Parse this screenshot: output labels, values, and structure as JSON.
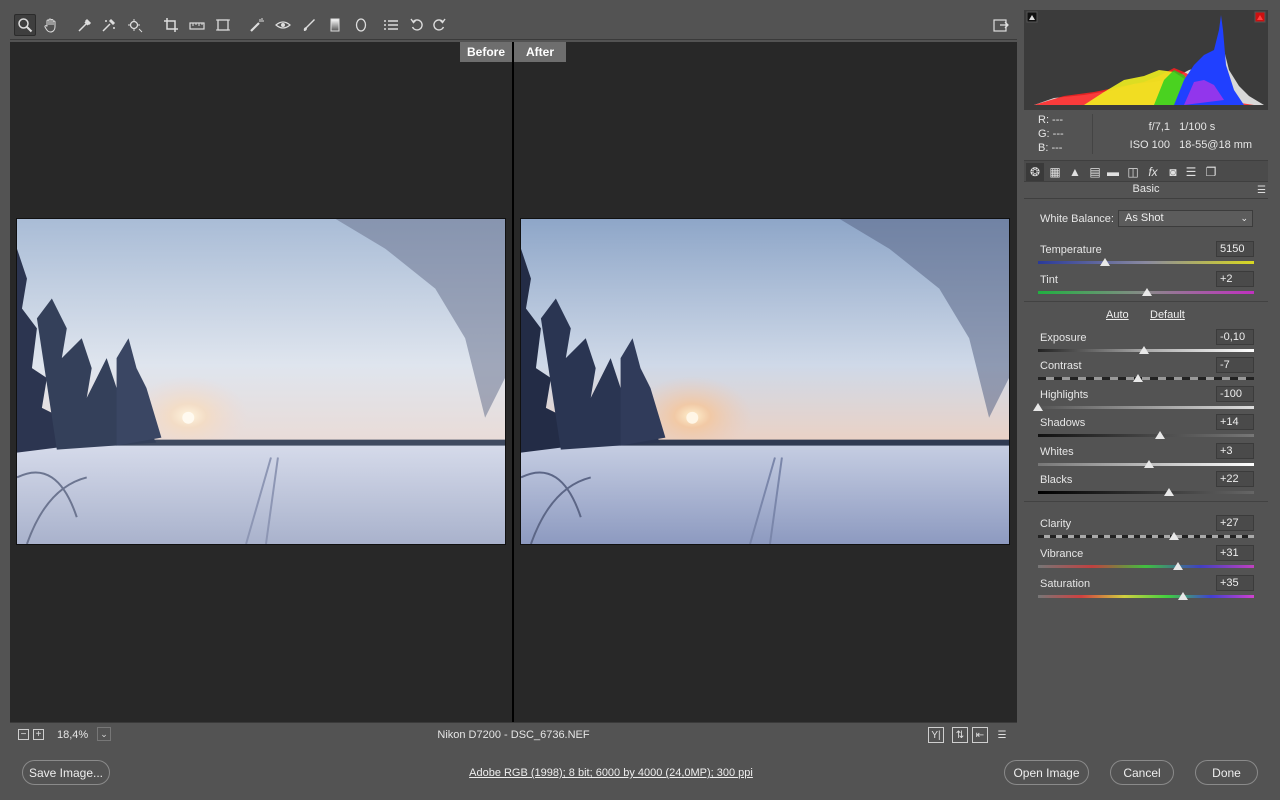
{
  "toolbar": {
    "tools": [
      {
        "name": "zoom-tool",
        "icon": "magnifier-icon"
      },
      {
        "name": "hand-tool",
        "icon": "hand-icon"
      },
      {
        "name": "white-balance-tool",
        "icon": "eyedropper-icon"
      },
      {
        "name": "color-sampler-tool",
        "icon": "sampler-icon"
      },
      {
        "name": "targeted-adjustment-tool",
        "icon": "target-adjust-icon"
      },
      {
        "name": "crop-tool",
        "icon": "crop-icon"
      },
      {
        "name": "straighten-tool",
        "icon": "straighten-icon"
      },
      {
        "name": "transform-tool",
        "icon": "transform-icon"
      },
      {
        "name": "spot-removal-tool",
        "icon": "spot-removal-icon"
      },
      {
        "name": "red-eye-tool",
        "icon": "red-eye-icon"
      },
      {
        "name": "adjustment-brush-tool",
        "icon": "brush-icon"
      },
      {
        "name": "graduated-filter-tool",
        "icon": "graduated-filter-icon"
      },
      {
        "name": "radial-filter-tool",
        "icon": "radial-filter-icon"
      },
      {
        "name": "preferences-tool",
        "icon": "list-icon"
      },
      {
        "name": "rotate-left-tool",
        "icon": "rotate-ccw-icon"
      },
      {
        "name": "rotate-right-tool",
        "icon": "rotate-cw-icon"
      }
    ]
  },
  "preview": {
    "before_label": "Before",
    "after_label": "After"
  },
  "status": {
    "zoom": "18,4%",
    "file_info": "Nikon D7200  -  DSC_6736.NEF"
  },
  "readout": {
    "r": "R:   ---",
    "g": "G:   ---",
    "b": "B:   ---",
    "aperture": "f/7,1",
    "shutter": "1/100 s",
    "iso": "ISO 100",
    "lens": "18-55@18 mm"
  },
  "panel": {
    "title": "Basic",
    "white_balance_label": "White Balance:",
    "white_balance_value": "As Shot",
    "auto_label": "Auto",
    "default_label": "Default",
    "sliders": [
      {
        "label": "Temperature",
        "value": "5150",
        "position": 0.31,
        "track": "linear-gradient(to right,#2a3a9a,#8a8aa0,#d8d820)"
      },
      {
        "label": "Tint",
        "value": "+2",
        "position": 0.505,
        "track": "linear-gradient(to right,#20b040,#8a8a8a,#c030c0)"
      },
      {
        "label": "Exposure",
        "value": "-0,10",
        "position": 0.49,
        "track": "linear-gradient(to right,#222,#aaa,#fff)"
      },
      {
        "label": "Contrast",
        "value": "-7",
        "position": 0.465,
        "track": "repeating-linear-gradient(to right,#222 0,#222 8px,#999 8px,#999 16px)"
      },
      {
        "label": "Highlights",
        "value": "-100",
        "position": 0.0,
        "track": "linear-gradient(to right,#555,#ddd)"
      },
      {
        "label": "Shadows",
        "value": "+14",
        "position": 0.565,
        "track": "linear-gradient(to right,#111,#777)"
      },
      {
        "label": "Whites",
        "value": "+3",
        "position": 0.515,
        "track": "linear-gradient(to right,#777,#fff)"
      },
      {
        "label": "Blacks",
        "value": "+22",
        "position": 0.605,
        "track": "linear-gradient(to right,#000,#666)"
      },
      {
        "label": "Clarity",
        "value": "+27",
        "position": 0.63,
        "track": "repeating-linear-gradient(to right,#222 0,#222 6px,#aaa 6px,#aaa 12px)"
      },
      {
        "label": "Vibrance",
        "value": "+31",
        "position": 0.65,
        "track": "linear-gradient(to right,#777,#c04040,#40c040,#4040c0,#c040c0)"
      },
      {
        "label": "Saturation",
        "value": "+35",
        "position": 0.67,
        "track": "linear-gradient(to right,#777,#d04040,#d0d040,#40d040,#4040d0,#d040d0)"
      }
    ]
  },
  "buttons": {
    "save": "Save Image...",
    "open": "Open Image",
    "cancel": "Cancel",
    "done": "Done"
  },
  "workflow": "Adobe RGB (1998); 8 bit; 6000 by 4000 (24,0MP); 300 ppi"
}
